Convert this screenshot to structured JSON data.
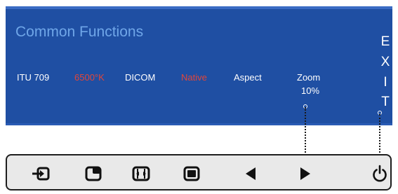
{
  "osd": {
    "title": "Common Functions",
    "functions": [
      {
        "label": "ITU 709",
        "active": false
      },
      {
        "label": "6500°K",
        "active": true
      },
      {
        "label": "DICOM",
        "active": false
      },
      {
        "label": "Native",
        "active": true
      },
      {
        "label": "Aspect",
        "active": false
      },
      {
        "label": "Zoom",
        "active": false
      }
    ],
    "zoom_value": "10%",
    "exit_letters": [
      "E",
      "X",
      "I",
      "T"
    ]
  },
  "buttons": [
    {
      "name": "input-source-icon"
    },
    {
      "name": "pip-icon"
    },
    {
      "name": "aspect-icon"
    },
    {
      "name": "fill-screen-icon"
    },
    {
      "name": "left-arrow-icon"
    },
    {
      "name": "right-arrow-icon"
    },
    {
      "name": "power-icon"
    }
  ],
  "colors": {
    "osd_background": "#1f4fa3",
    "title": "#6fa6e8",
    "active_item": "#e0463a",
    "text": "#ffffff"
  }
}
